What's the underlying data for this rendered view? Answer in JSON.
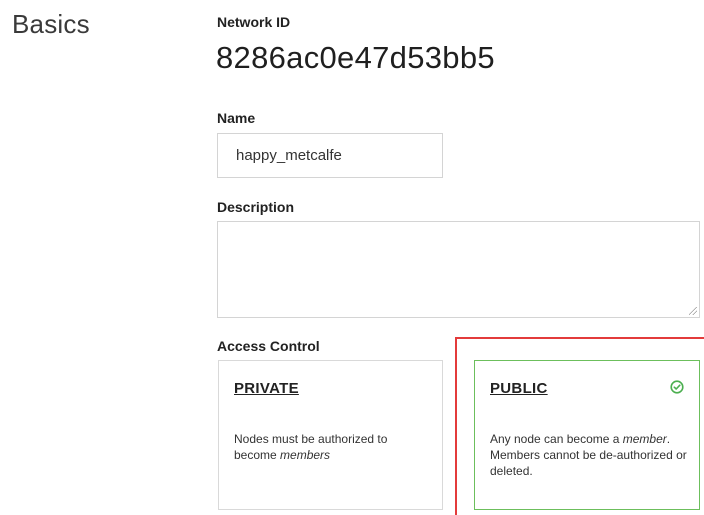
{
  "section": {
    "title": "Basics"
  },
  "network_id": {
    "label": "Network ID",
    "value": "8286ac0e47d53bb5"
  },
  "name": {
    "label": "Name",
    "value": "happy_metcalfe"
  },
  "description": {
    "label": "Description",
    "value": ""
  },
  "access_control": {
    "label": "Access Control",
    "private": {
      "title": "PRIVATE",
      "desc_pre": "Nodes must be authorized to become ",
      "desc_em": "members",
      "desc_post": ""
    },
    "public": {
      "title": "PUBLIC",
      "selected": true,
      "desc_pre": "Any node can become a ",
      "desc_em": "member",
      "desc_post": ". Members cannot be de-authorized or deleted.",
      "icon": "check-circle-icon"
    }
  },
  "colors": {
    "selected_border": "#6cbf5c",
    "check_icon": "#4caf50",
    "highlight": "#e33b3b"
  }
}
